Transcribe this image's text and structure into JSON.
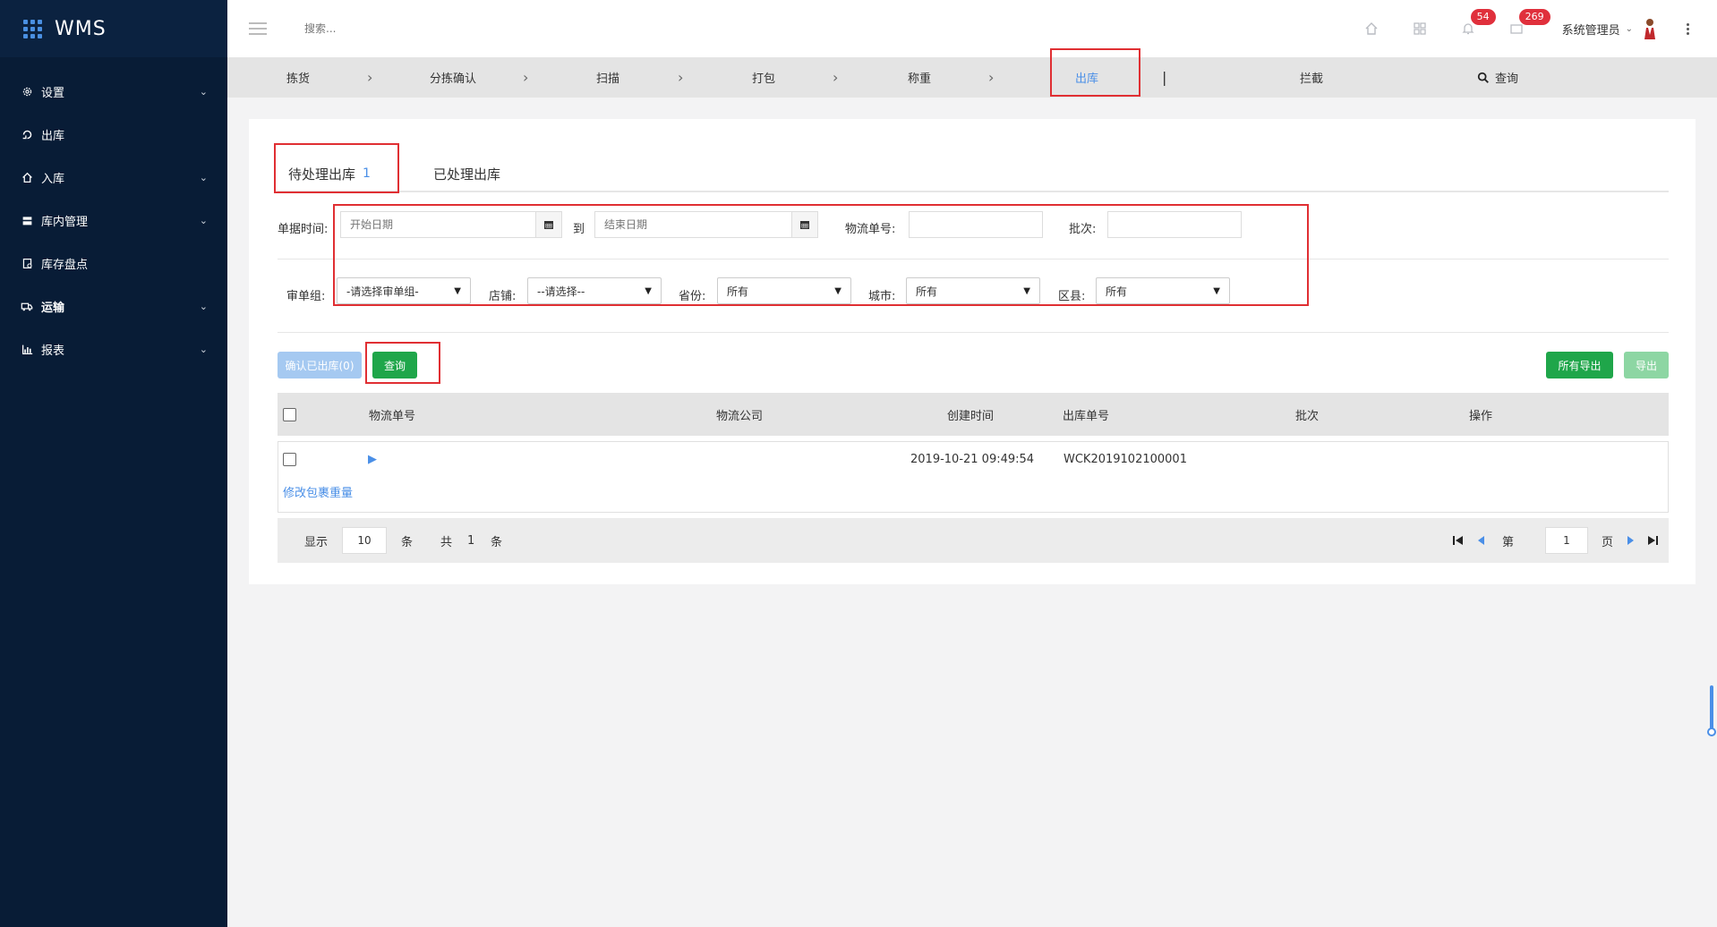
{
  "brand": {
    "name": "WMS"
  },
  "sidebar": {
    "items": [
      {
        "label": "设置",
        "icon": "gear-icon",
        "has_children": true
      },
      {
        "label": "出库",
        "icon": "outbound-icon",
        "has_children": false
      },
      {
        "label": "入库",
        "icon": "inbound-icon",
        "has_children": true
      },
      {
        "label": "库内管理",
        "icon": "warehouse-icon",
        "has_children": true
      },
      {
        "label": "库存盘点",
        "icon": "inventory-icon",
        "has_children": false
      },
      {
        "label": "运输",
        "icon": "truck-icon",
        "has_children": true
      },
      {
        "label": "报表",
        "icon": "chart-icon",
        "has_children": true
      }
    ]
  },
  "topbar": {
    "search_placeholder": "搜索...",
    "notifications_count": "54",
    "messages_count": "269",
    "user_name": "系统管理员"
  },
  "steps": {
    "items": [
      "拣货",
      "分拣确认",
      "扫描",
      "打包",
      "称重",
      "出库"
    ],
    "active": "出库",
    "separator": "|",
    "intercept": "拦截",
    "query": "查询"
  },
  "tabs": {
    "pending_label": "待处理出库",
    "pending_count": "1",
    "processed_label": "已处理出库"
  },
  "filters": {
    "date_label": "单据时间:",
    "start_placeholder": "开始日期",
    "to_label": "到",
    "end_placeholder": "结束日期",
    "tracking_label": "物流单号:",
    "batch_label": "批次:",
    "review_group_label": "审单组:",
    "review_group_value": "-请选择审单组-",
    "store_label": "店铺:",
    "store_value": "--请选择--",
    "province_label": "省份:",
    "province_value": "所有",
    "city_label": "城市:",
    "city_value": "所有",
    "district_label": "区县:",
    "district_value": "所有"
  },
  "actions": {
    "confirm_label": "确认已出库(0)",
    "query_label": "查询",
    "export_all_label": "所有导出",
    "export_label": "导出"
  },
  "table": {
    "columns": [
      "物流单号",
      "物流公司",
      "创建时间",
      "出库单号",
      "批次",
      "操作"
    ],
    "rows": [
      {
        "tracking_no": "",
        "company": "",
        "created_at": "2019-10-21 09:49:54",
        "outbound_no": "WCK2019102100001",
        "batch": "",
        "action_link": "修改包裹重量"
      }
    ]
  },
  "pagination": {
    "show_label": "显示",
    "page_size": "10",
    "unit": "条",
    "total_label": "共",
    "total": "1",
    "total_unit": "条",
    "page_prefix": "第",
    "current_page": "1",
    "page_suffix": "页"
  },
  "colors": {
    "sidebar_bg": "#081c36",
    "accent_blue": "#4a8fe7",
    "green": "#1fa64a",
    "highlight_red": "#e02f33",
    "badge_red": "#e0303c"
  }
}
